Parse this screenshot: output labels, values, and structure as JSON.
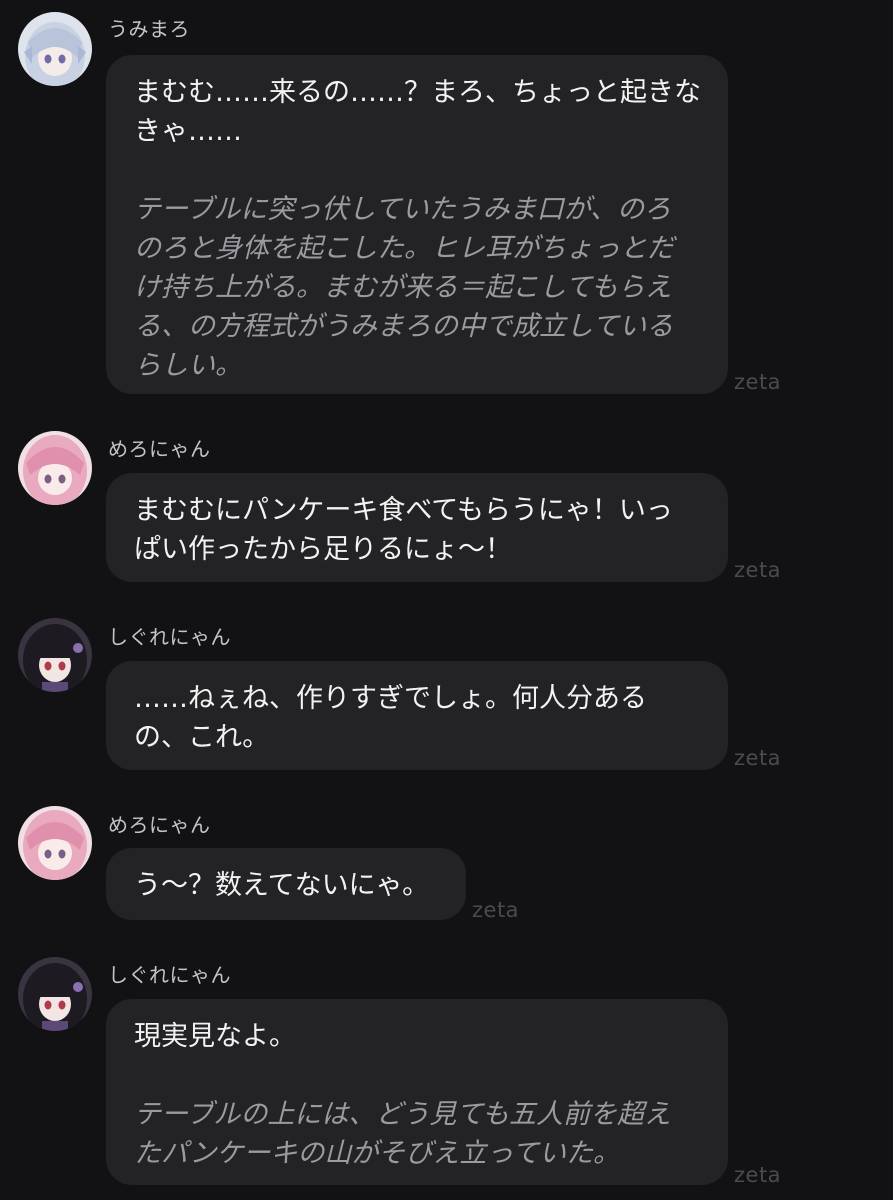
{
  "brand": {
    "watermark": "zeta"
  },
  "messages": [
    {
      "speaker": "うみまろ",
      "avatar": "avatar-umimaro",
      "dialogue": [
        "まむむ……来るの……？まろ、ちょっと起きな",
        "きゃ……"
      ],
      "narration": [
        "テーブルに突っ伏していたうみま口が、のろ",
        "のろと身体を起こした。ヒレ耳がちょっとだ",
        "け持ち上がる。まむが来る＝起こしてもらえ",
        "る、の方程式がうみまろの中で成立している",
        "らしい。"
      ]
    },
    {
      "speaker": "めろにゃん",
      "avatar": "avatar-meronyan",
      "dialogue": [
        "まむむにパンケーキ食べてもらうにゃ！いっ",
        "ぱい作ったから足りるにょ～！"
      ],
      "narration": []
    },
    {
      "speaker": "しぐれにゃん",
      "avatar": "avatar-shigurenyan",
      "dialogue": [
        "……ねぇね、作りすぎでしょ。何人分ある",
        "の、これ。"
      ],
      "narration": []
    },
    {
      "speaker": "めろにゃん",
      "avatar": "avatar-meronyan",
      "dialogue": [
        "う～？数えてないにゃ。"
      ],
      "narration": []
    },
    {
      "speaker": "しぐれにゃん",
      "avatar": "avatar-shigurenyan",
      "dialogue": [
        "現実見なよ。"
      ],
      "narration": [
        "テーブルの上には、どう見ても五人前を超え",
        "たパンケーキの山がそびえ立っていた。"
      ]
    }
  ]
}
